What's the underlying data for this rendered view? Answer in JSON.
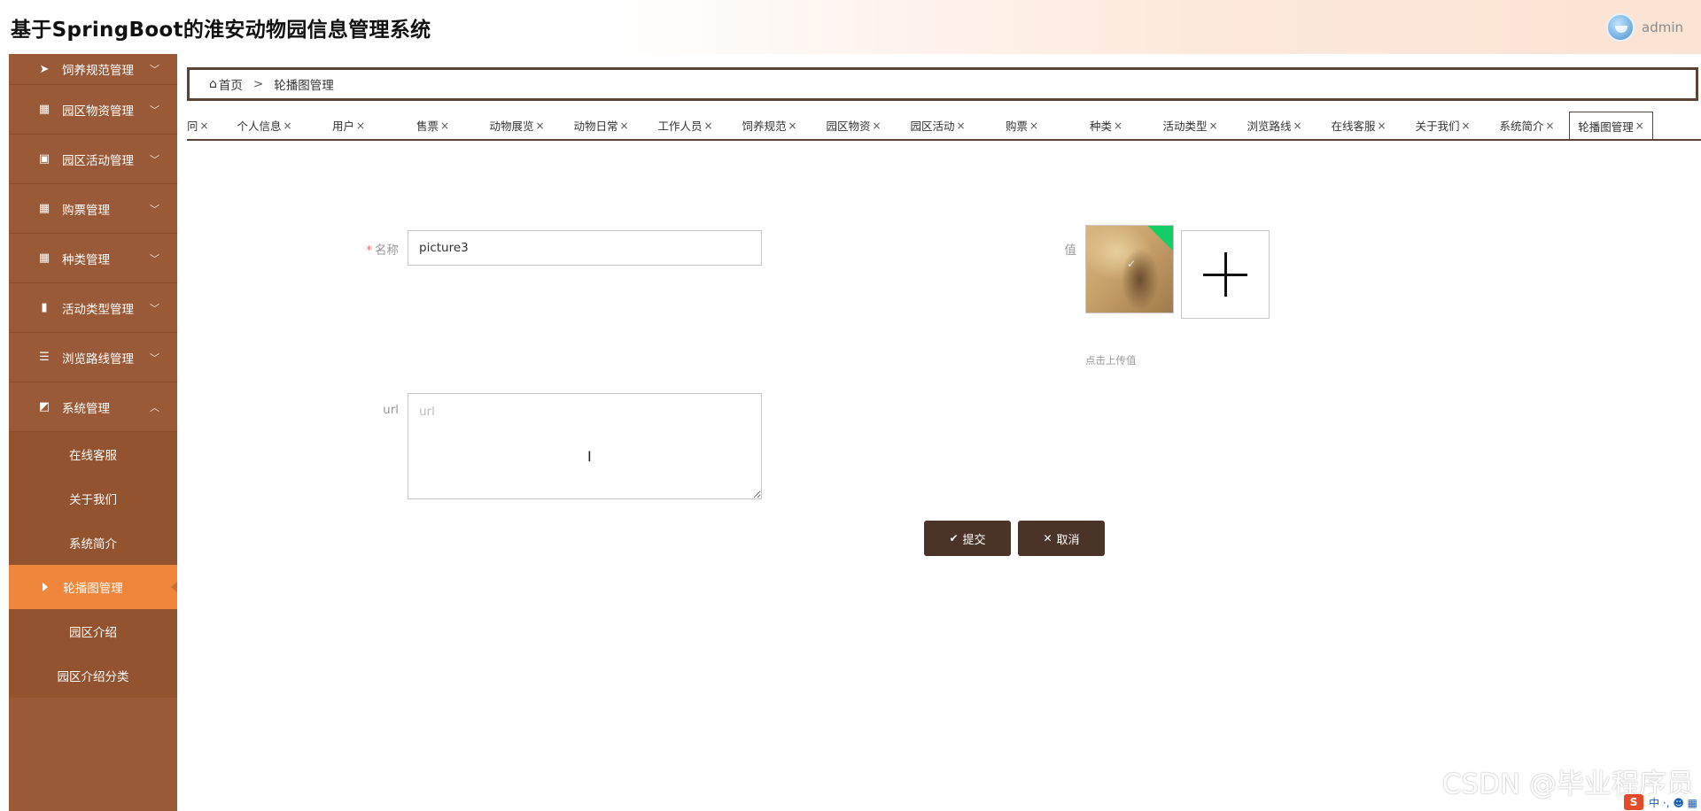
{
  "header": {
    "title": "基于SpringBoot的淮安动物园信息管理系统",
    "username": "admin"
  },
  "sidebar": {
    "items": [
      {
        "label": "饲养规范管理",
        "icon": "send-icon",
        "glyph": "➤",
        "arrow": "﹀"
      },
      {
        "label": "园区物资管理",
        "icon": "grid-icon",
        "glyph": "▦",
        "arrow": "﹀"
      },
      {
        "label": "园区活动管理",
        "icon": "clipboard-icon",
        "glyph": "▣",
        "arrow": "﹀"
      },
      {
        "label": "购票管理",
        "icon": "grid-icon",
        "glyph": "▦",
        "arrow": "﹀"
      },
      {
        "label": "种类管理",
        "icon": "grid-icon",
        "glyph": "▦",
        "arrow": "﹀"
      },
      {
        "label": "活动类型管理",
        "icon": "bar-chart-icon",
        "glyph": "▮",
        "arrow": "﹀"
      },
      {
        "label": "浏览路线管理",
        "icon": "list-icon",
        "glyph": "☰",
        "arrow": "﹀"
      },
      {
        "label": "系统管理",
        "icon": "area-chart-icon",
        "glyph": "◩",
        "arrow": "︿"
      }
    ],
    "subitems": [
      {
        "label": "在线客服"
      },
      {
        "label": "关于我们"
      },
      {
        "label": "系统简介"
      },
      {
        "label": "轮播图管理",
        "active": true
      },
      {
        "label": "园区介绍"
      },
      {
        "label": "园区介绍分类"
      }
    ]
  },
  "breadcrumb": {
    "home": "首页",
    "separator": ">",
    "current": "轮播图管理"
  },
  "tags": [
    {
      "label": "冋",
      "close": "×"
    },
    {
      "label": "个人信息",
      "close": "×"
    },
    {
      "label": "用户",
      "close": "×"
    },
    {
      "label": "售票",
      "close": "×"
    },
    {
      "label": "动物展览",
      "close": "×"
    },
    {
      "label": "动物日常",
      "close": "×"
    },
    {
      "label": "工作人员",
      "close": "×"
    },
    {
      "label": "饲养规范",
      "close": "×"
    },
    {
      "label": "园区物资",
      "close": "×"
    },
    {
      "label": "园区活动",
      "close": "×"
    },
    {
      "label": "购票",
      "close": "×"
    },
    {
      "label": "种类",
      "close": "×"
    },
    {
      "label": "活动类型",
      "close": "×"
    },
    {
      "label": "浏览路线",
      "close": "×"
    },
    {
      "label": "在线客服",
      "close": "×"
    },
    {
      "label": "关于我们",
      "close": "×"
    },
    {
      "label": "系统简介",
      "close": "×"
    },
    {
      "label": "轮播图管理",
      "close": "×"
    }
  ],
  "form": {
    "name_required_mark": "*",
    "name_label": "名称",
    "name_value": "picture3",
    "value_label": "值",
    "upload_hint": "点击上传值",
    "url_label": "url",
    "url_placeholder": "url",
    "url_value": "",
    "submit_label": "提交",
    "cancel_label": "取消"
  },
  "overlay": {
    "watermark": "CSDN @毕业程序员",
    "ime_logo": "S",
    "ime_text": "中 ·, ☻ ▦"
  },
  "colors": {
    "sidebar": "#9a5a36",
    "active_menu": "#f0853c",
    "button": "#4a3428",
    "upload_badge": "#13ce66"
  }
}
